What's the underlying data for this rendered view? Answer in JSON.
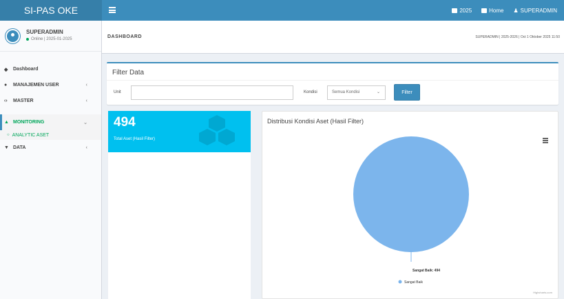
{
  "app": {
    "brand": "SI-PAS OKE"
  },
  "navbar": {
    "items": [
      {
        "label": "2025",
        "icon": "table-icon"
      },
      {
        "label": "Home",
        "icon": "home-icon"
      },
      {
        "label": "SUPERADMIN",
        "icon": "user-icon"
      }
    ]
  },
  "user": {
    "name": "SUPERADMIN",
    "status": "Online | 2025-01-2025"
  },
  "sidebar": {
    "items": [
      {
        "label": "Dashboard",
        "icon": "dashboard-icon",
        "caret": ""
      },
      {
        "label": "MANAJEMEN USER",
        "icon": "users-icon",
        "caret": "‹"
      },
      {
        "label": "MASTER",
        "icon": "code-icon",
        "caret": "‹"
      },
      {
        "label": "MONITORING",
        "icon": "monitor-icon",
        "caret": "⌄"
      },
      {
        "label": "DATA",
        "icon": "filter-icon",
        "caret": "‹"
      }
    ],
    "subitems": [
      {
        "label": "ANALYTIC ASET",
        "icon": "circle-icon"
      }
    ]
  },
  "header": {
    "title": "DASHBOARD",
    "breadcrumb": "SUPERADMIN | 2025-2026 | Oct 1 Oktober 2025 11:50"
  },
  "filter": {
    "title": "Filter Data",
    "unit_label": "Unit",
    "unit_value": "",
    "kondisi_label": "Kondisi",
    "kondisi_value": "Semua Kondisi",
    "button_label": "Filter"
  },
  "info": {
    "number": "494",
    "label": "Total Aset (Hasil Filter)"
  },
  "chart_data": {
    "type": "pie",
    "title": "Distribusi Kondisi Aset (Hasil Filter)",
    "categories": [
      "Sangat Baik"
    ],
    "values": [
      494
    ],
    "data_labels": [
      "Sangat Baik: 494"
    ],
    "legend": [
      "Sangat Baik"
    ],
    "legend_position": "bottom",
    "colors": [
      "#7cb5ec"
    ],
    "credits": "Highcharts.com"
  },
  "colors": {
    "primary": "#3c8dbc",
    "info": "#00c0ef",
    "success": "#00a65a"
  }
}
